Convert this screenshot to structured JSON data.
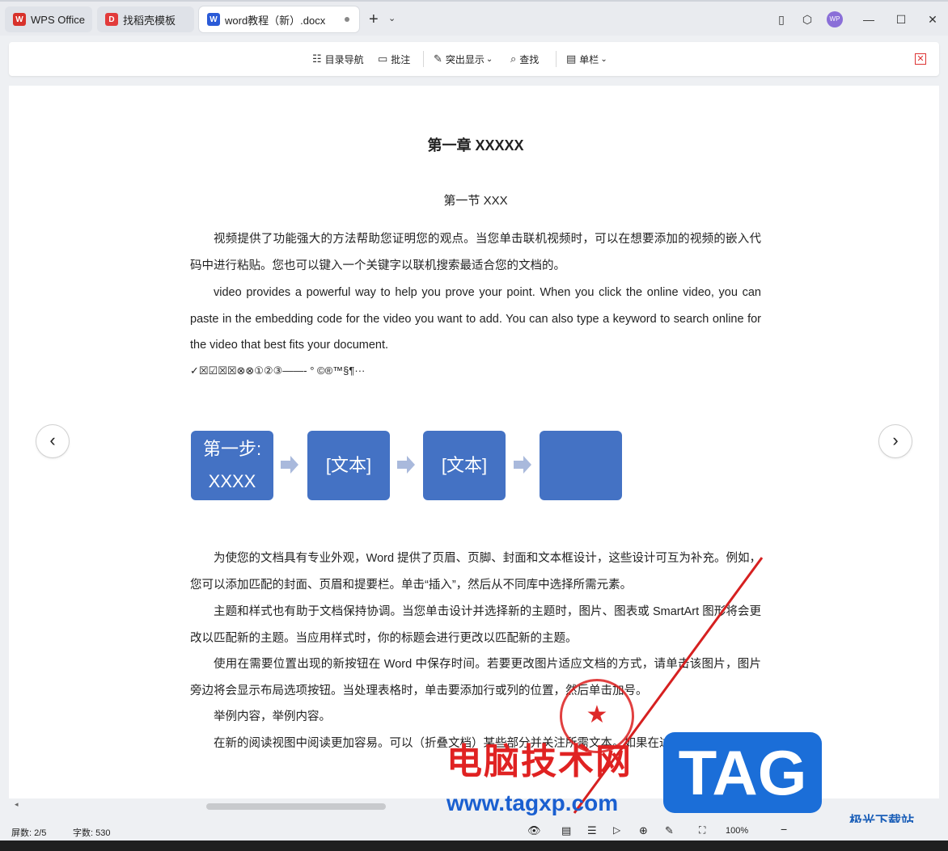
{
  "tabs": [
    {
      "label": "WPS Office",
      "icon": "wps-logo-icon",
      "color": "#d8322b"
    },
    {
      "label": "找稻壳模板",
      "icon": "docer-icon",
      "color": "#e23b3b"
    },
    {
      "label": "word教程（新）.docx",
      "icon": "word-doc-icon",
      "color": "#2b5bd7",
      "active": true
    }
  ],
  "avatar_text": "WP",
  "toolbar": {
    "nav_label": "目录导航",
    "comment_label": "批注",
    "highlight_label": "突出显示",
    "find_label": "查找",
    "column_label": "单栏"
  },
  "document": {
    "chapter_title": "第一章  XXXXX",
    "section_title": "第一节  XXX",
    "para1": "视频提供了功能强大的方法帮助您证明您的观点。当您单击联机视频时，可以在想要添加的视频的嵌入代码中进行粘贴。您也可以键入一个关键字以联机搜索最适合您的文档的。",
    "para2": "video provides a powerful way to help you prove your point. When you click the online video, you can paste in the embedding code for the video you want to add. You can also type a keyword to search online for the video that best fits your document.",
    "symbols": "✓☒☑☒☒⊗⊗①②③——-  °  ©®™§¶···",
    "smartart": [
      "第一步:\nXXXX",
      "[文本]",
      "[文本]",
      ""
    ],
    "para3": "为使您的文档具有专业外观，Word 提供了页眉、页脚、封面和文本框设计，这些设计可互为补充。例如，您可以添加匹配的封面、页眉和提要栏。单击“插入”，然后从不同库中选择所需元素。",
    "para4": "主题和样式也有助于文档保持协调。当您单击设计并选择新的主题时，图片、图表或 SmartArt 图形将会更改以匹配新的主题。当应用样式时，你的标题会进行更改以匹配新的主题。",
    "para5": "使用在需要位置出现的新按钮在 Word 中保存时间。若要更改图片适应文档的方式，请单击该图片，图片旁边将会显示布局选项按钮。当处理表格时，单击要添加行或列的位置，然后单击加号。",
    "para6": "举例内容，举例内容。",
    "para7": "在新的阅读视图中阅读更加容易。可以（折叠文档）某些部分并关注所需文本。如果在达到结尾"
  },
  "status": {
    "pages": "屏数: 2/5",
    "words": "字数: 530",
    "zoom": "100%"
  },
  "overlay": {
    "watermark_cn": "电脑技术网",
    "watermark_url": "www.tagxp.com",
    "tag": "TAG",
    "brand": "极光下载站"
  },
  "colors": {
    "accent": "#4472c4",
    "wps_red": "#d8322b"
  }
}
